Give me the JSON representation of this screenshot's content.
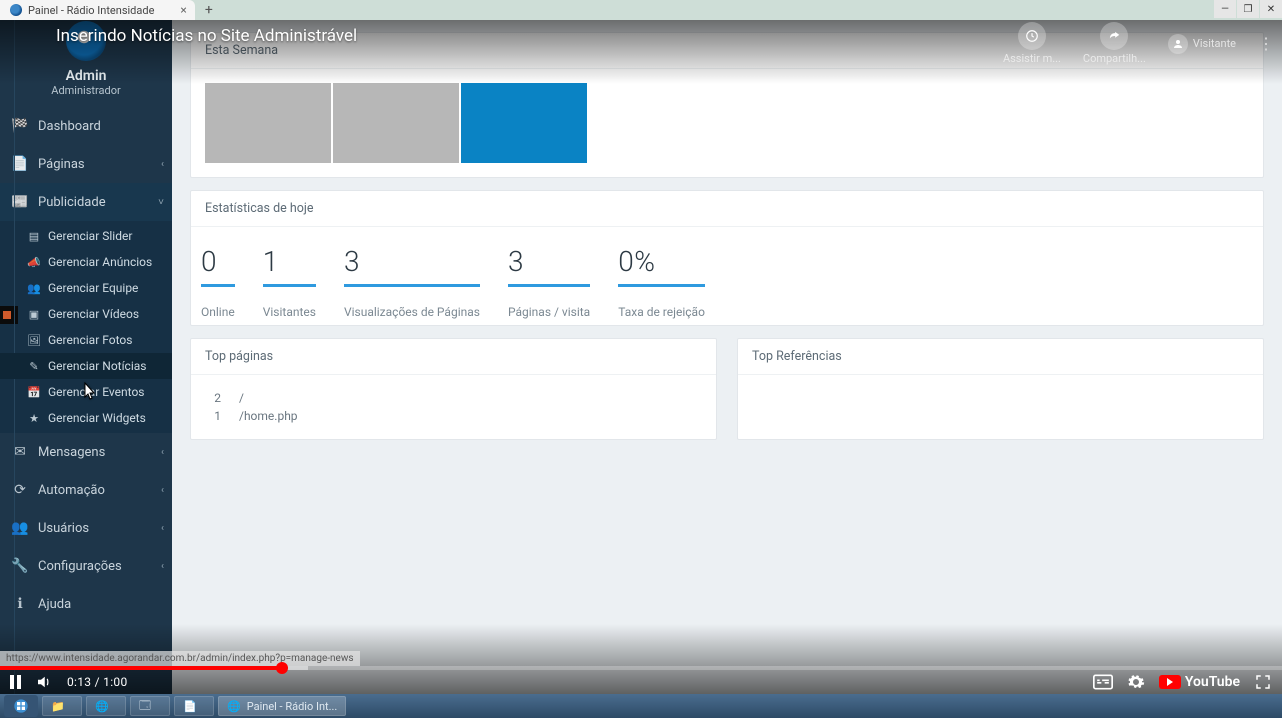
{
  "browser": {
    "tab_title": "Painel - Rádio Intensidade",
    "link_preview": "https://www.intensidade.agorandar.com.br/admin/index.php?p=manage-news"
  },
  "video": {
    "title": "Inserindo Notícias no Site Administrável",
    "watch_later": "Assistir m...",
    "share": "Compartilh...",
    "visitor": "Visitante",
    "time_current": "0:13",
    "time_total": "1:00",
    "played_pct": 22,
    "buffered_pct": 24,
    "youtube": "YouTube"
  },
  "sidebar": {
    "user_name": "Admin",
    "user_role": "Administrador",
    "items": [
      {
        "label": "Dashboard",
        "icon": "⌂",
        "expandable": false
      },
      {
        "label": "Páginas",
        "icon": "📄",
        "expandable": true
      },
      {
        "label": "Publicidade",
        "icon": "📰",
        "expandable": true,
        "open": true,
        "children": [
          {
            "label": "Gerenciar Slider",
            "icon": "▤"
          },
          {
            "label": "Gerenciar Anúncios",
            "icon": "📣"
          },
          {
            "label": "Gerenciar Equipe",
            "icon": "👥"
          },
          {
            "label": "Gerenciar Vídeos",
            "icon": "▣"
          },
          {
            "label": "Gerenciar Fotos",
            "icon": "🖼"
          },
          {
            "label": "Gerenciar Notícias",
            "icon": "✎"
          },
          {
            "label": "Gerenciar Eventos",
            "icon": "📅"
          },
          {
            "label": "Gerenciar Widgets",
            "icon": "★"
          }
        ]
      },
      {
        "label": "Mensagens",
        "icon": "✉",
        "expandable": true
      },
      {
        "label": "Automação",
        "icon": "⟳",
        "expandable": true
      },
      {
        "label": "Usuários",
        "icon": "👤",
        "expandable": true
      },
      {
        "label": "Configurações",
        "icon": "🔧",
        "expandable": true
      },
      {
        "label": "Ajuda",
        "icon": "ℹ",
        "expandable": false
      }
    ]
  },
  "panels": {
    "week_title": "Esta Semana",
    "today_title": "Estatísticas de hoje",
    "top_pages_title": "Top páginas",
    "top_refs_title": "Top Referências"
  },
  "stats": [
    {
      "value": "0",
      "label": "Online"
    },
    {
      "value": "1",
      "label": "Visitantes"
    },
    {
      "value": "3",
      "label": "Visualizações de Páginas"
    },
    {
      "value": "3",
      "label": "Páginas / visita"
    },
    {
      "value": "0%",
      "label": "Taxa de rejeição"
    }
  ],
  "top_pages": [
    {
      "count": "2",
      "path": "/"
    },
    {
      "count": "1",
      "path": "/home.php"
    }
  ],
  "taskbar": {
    "items": [
      {
        "label": "",
        "icon": "📁"
      },
      {
        "label": "",
        "icon": "🌐"
      },
      {
        "label": "",
        "icon": "🗔"
      },
      {
        "label": "",
        "icon": "📄"
      },
      {
        "label": "Painel - Rádio Int...",
        "icon": "🌐",
        "active": true
      }
    ]
  }
}
